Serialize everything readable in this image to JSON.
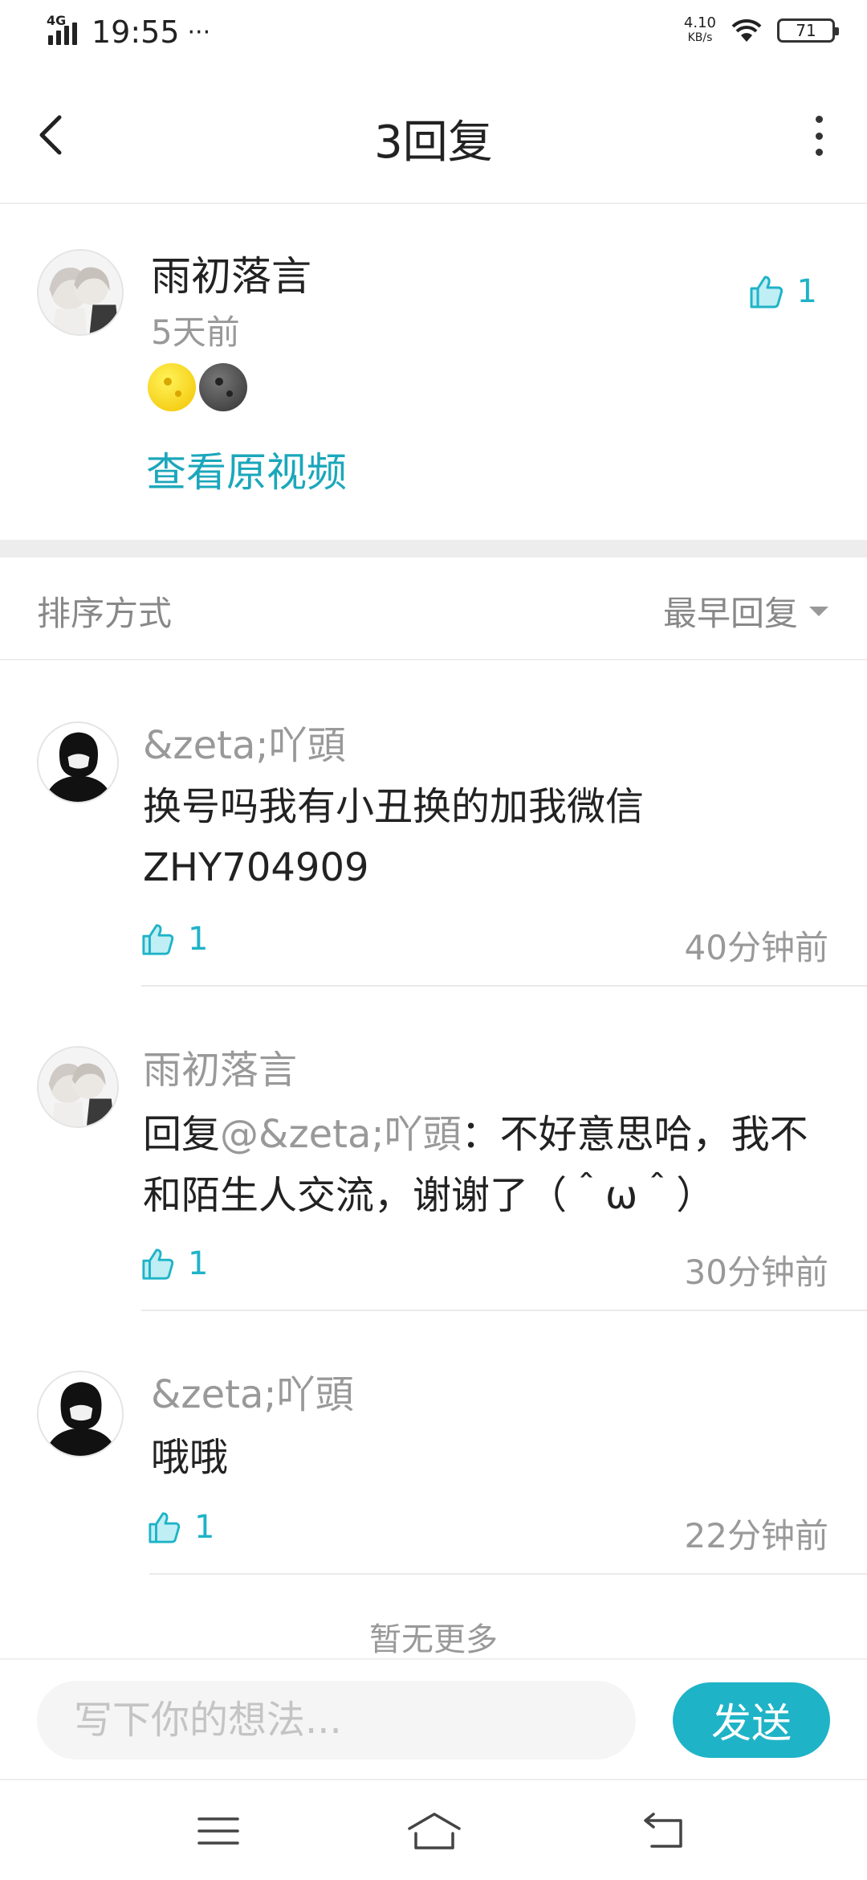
{
  "status_bar": {
    "network": "4G",
    "time": "19:55",
    "dots": "···",
    "net_speed_value": "4.10",
    "net_speed_unit": "KB/s",
    "battery": "71",
    "icons": [
      "signal-icon",
      "wifi-icon",
      "battery-icon"
    ]
  },
  "header": {
    "title": "3回复",
    "icons": [
      "back-arrow-icon",
      "more-vertical-icon"
    ]
  },
  "main_comment": {
    "author": "雨初落言",
    "time": "5天前",
    "likes": "1",
    "emoji": [
      "yellow-moon-emoji",
      "dark-moon-emoji"
    ],
    "view_original_label": "查看原视频"
  },
  "sort": {
    "label": "排序方式",
    "selected": "最早回复"
  },
  "replies": [
    {
      "author": "&zeta;吖頭",
      "text": "换号吗我有小丑换的加我微信ZHY704909",
      "likes": "1",
      "time": "40分钟前"
    },
    {
      "author": "雨初落言",
      "reply_prefix": "回复",
      "reply_to": "@&zeta;吖頭",
      "text": "：不好意思哈，我不和陌生人交流，谢谢了（＾ω＾）",
      "likes": "1",
      "time": "30分钟前"
    },
    {
      "author": "&zeta;吖頭",
      "text": "哦哦",
      "likes": "1",
      "time": "22分钟前"
    }
  ],
  "footer_note": "暂无更多",
  "composer": {
    "placeholder": "写下你的想法...",
    "send_label": "发送"
  },
  "system_nav": {
    "icons": [
      "menu-icon",
      "home-icon",
      "back-icon"
    ]
  },
  "colors": {
    "accent": "#1fb3c7",
    "link": "#1ba7bb",
    "muted_text": "#999999",
    "divider": "#eeeeee"
  }
}
